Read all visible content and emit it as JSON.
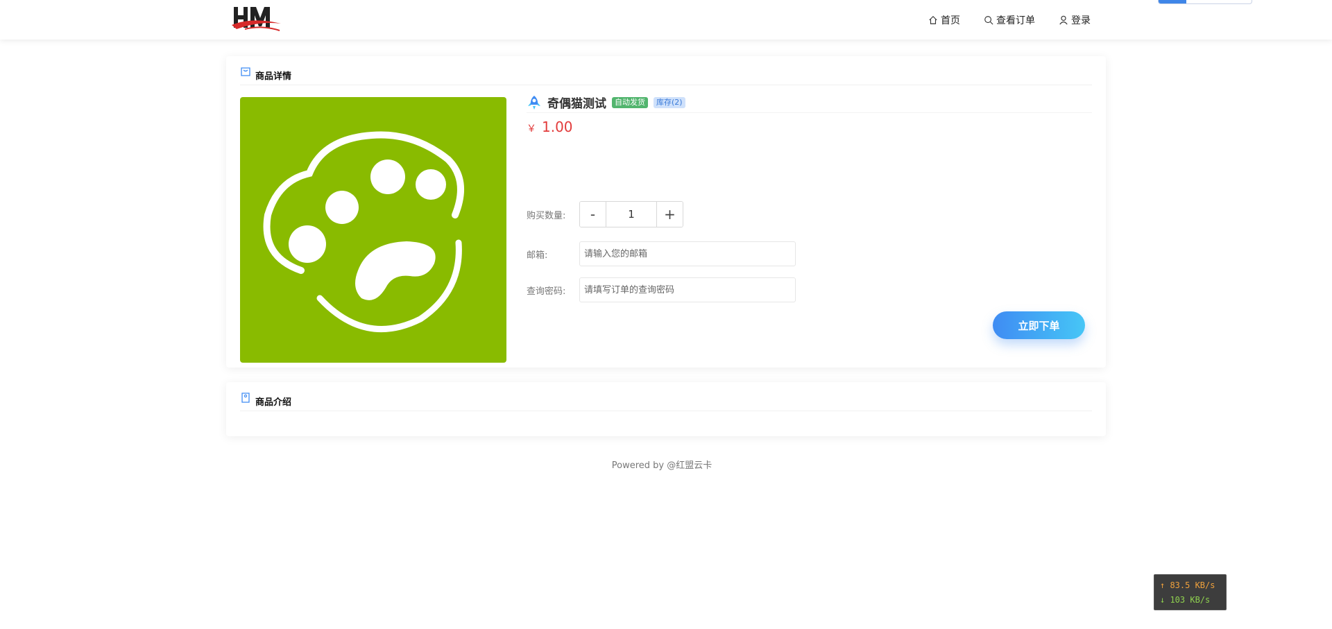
{
  "header": {
    "nav": {
      "home": "首页",
      "orders": "查看订单",
      "login": "登录"
    }
  },
  "detail": {
    "section_title": "商品详情",
    "product_name": "奇偶猫测试",
    "badge_auto": "自动发货",
    "badge_stock": "库存(2)",
    "currency": "￥",
    "price": "1.00",
    "qty_label": "购买数量:",
    "qty_minus": "-",
    "qty_value": "1",
    "qty_plus": "+",
    "email_label": "邮箱:",
    "email_placeholder": "请输入您的邮箱",
    "pwd_label": "查询密码:",
    "pwd_placeholder": "请填写订单的查询密码",
    "submit_label": "立即下单"
  },
  "intro": {
    "section_title": "商品介绍"
  },
  "footer": {
    "text": "Powered by @红盟云卡"
  },
  "net": {
    "up": "↑ 83.5 KB/s",
    "down": "↓ 103 KB/s"
  },
  "colors": {
    "accent": "#3f8cf3",
    "price": "#e23b3b",
    "product_bg": "#89bb00",
    "badge_auto": "#52b56e"
  }
}
